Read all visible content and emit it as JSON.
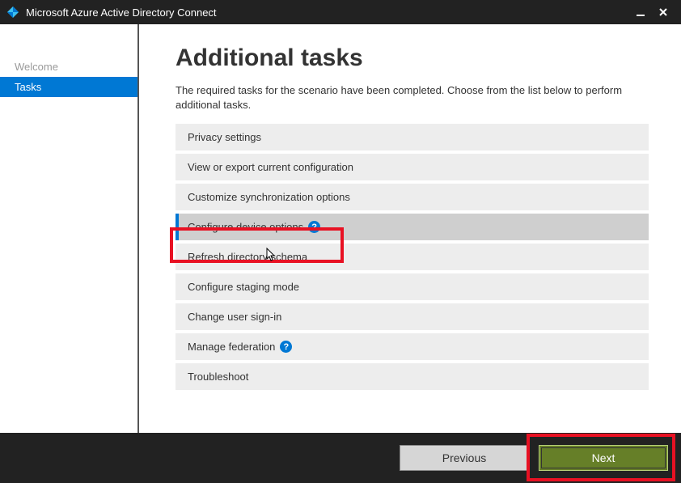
{
  "titlebar": {
    "title": "Microsoft Azure Active Directory Connect"
  },
  "sidebar": {
    "items": [
      {
        "label": "Welcome",
        "active": false
      },
      {
        "label": "Tasks",
        "active": true
      }
    ]
  },
  "content": {
    "heading": "Additional tasks",
    "description": "The required tasks for the scenario have been completed. Choose from the list below to perform additional tasks.",
    "tasks": [
      {
        "label": "Privacy settings",
        "selected": false,
        "help": false
      },
      {
        "label": "View or export current configuration",
        "selected": false,
        "help": false
      },
      {
        "label": "Customize synchronization options",
        "selected": false,
        "help": false
      },
      {
        "label": "Configure device options",
        "selected": true,
        "help": true
      },
      {
        "label": "Refresh directory schema",
        "selected": false,
        "help": false
      },
      {
        "label": "Configure staging mode",
        "selected": false,
        "help": false
      },
      {
        "label": "Change user sign-in",
        "selected": false,
        "help": false
      },
      {
        "label": "Manage federation",
        "selected": false,
        "help": true
      },
      {
        "label": "Troubleshoot",
        "selected": false,
        "help": false
      }
    ]
  },
  "footer": {
    "previous": "Previous",
    "next": "Next"
  },
  "helpGlyph": "?"
}
